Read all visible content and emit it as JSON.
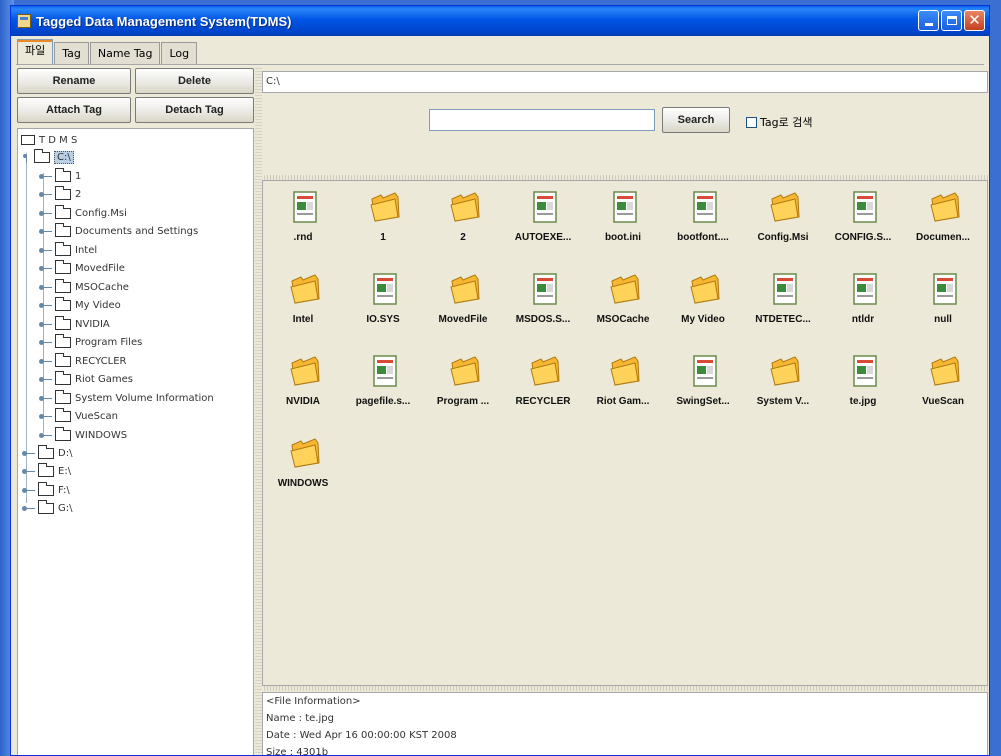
{
  "window": {
    "title": "Tagged Data Management System(TDMS)"
  },
  "tabs": [
    {
      "label": "파일",
      "active": true
    },
    {
      "label": "Tag"
    },
    {
      "label": "Name Tag"
    },
    {
      "label": "Log"
    }
  ],
  "actions": {
    "rename": "Rename",
    "delete": "Delete",
    "attach": "Attach Tag",
    "detach": "Detach Tag"
  },
  "tree": {
    "root": "T D M S",
    "selected_drive": "C:\\",
    "children": [
      "1",
      "2",
      "Config.Msi",
      "Documents and Settings",
      "Intel",
      "MovedFile",
      "MSOCache",
      "My Video",
      "NVIDIA",
      "Program Files",
      "RECYCLER",
      "Riot Games",
      "System Volume Information",
      "VueScan",
      "WINDOWS"
    ],
    "drives": [
      "D:\\",
      "E:\\",
      "F:\\",
      "G:\\"
    ]
  },
  "path": "C:\\",
  "search": {
    "value": "",
    "button": "Search",
    "checkbox_label": "Tag로 검색",
    "checked": false
  },
  "files": [
    {
      "name": ".rnd",
      "icon": "file"
    },
    {
      "name": "1",
      "icon": "folder"
    },
    {
      "name": "2",
      "icon": "folder"
    },
    {
      "name": "AUTOEXE...",
      "icon": "file"
    },
    {
      "name": "boot.ini",
      "icon": "file"
    },
    {
      "name": "bootfont....",
      "icon": "file"
    },
    {
      "name": "Config.Msi",
      "icon": "folder"
    },
    {
      "name": "CONFIG.S...",
      "icon": "file"
    },
    {
      "name": "Documen...",
      "icon": "folder"
    },
    {
      "name": "Intel",
      "icon": "folder"
    },
    {
      "name": "IO.SYS",
      "icon": "file"
    },
    {
      "name": "MovedFile",
      "icon": "folder"
    },
    {
      "name": "MSDOS.S...",
      "icon": "file"
    },
    {
      "name": "MSOCache",
      "icon": "folder"
    },
    {
      "name": "My Video",
      "icon": "folder"
    },
    {
      "name": "NTDETEC...",
      "icon": "file"
    },
    {
      "name": "ntldr",
      "icon": "file"
    },
    {
      "name": "null",
      "icon": "file"
    },
    {
      "name": "NVIDIA",
      "icon": "folder"
    },
    {
      "name": "pagefile.s...",
      "icon": "file"
    },
    {
      "name": "Program ...",
      "icon": "folder"
    },
    {
      "name": "RECYCLER",
      "icon": "folder"
    },
    {
      "name": "Riot Gam...",
      "icon": "folder"
    },
    {
      "name": "SwingSet...",
      "icon": "file"
    },
    {
      "name": "System V...",
      "icon": "folder"
    },
    {
      "name": "te.jpg",
      "icon": "file"
    },
    {
      "name": "VueScan",
      "icon": "folder"
    },
    {
      "name": "WINDOWS",
      "icon": "folder"
    }
  ],
  "info": {
    "header": "<File Information>",
    "name": "Name : te.jpg",
    "date": "Date : Wed Apr 16 00:00:00 KST 2008",
    "size": "Size : 4301b"
  },
  "colors": {
    "titlebar": "#0055e5",
    "folder": "#f7b733",
    "file_icon_bar": "#d94a32"
  }
}
